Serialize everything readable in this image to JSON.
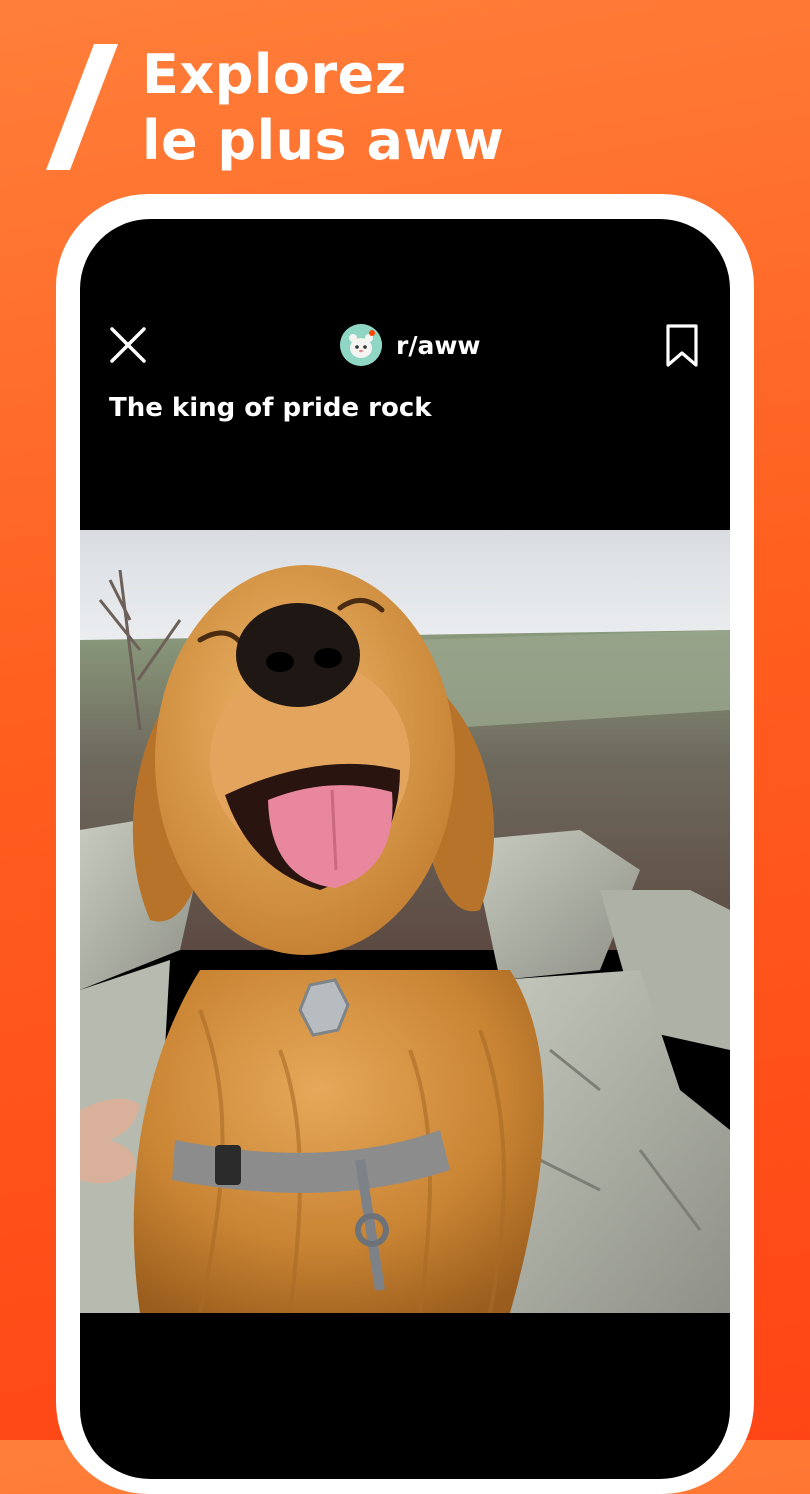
{
  "promo": {
    "title_line1": "Explorez",
    "title_line2": "le plus aww"
  },
  "post": {
    "community": "r/aww",
    "title": "The king of pride rock"
  },
  "icons": {
    "close": "close-icon",
    "bookmark": "bookmark-icon",
    "community_avatar": "subreddit-avatar-icon"
  },
  "colors": {
    "background_top": "#ff7f3a",
    "background_bottom": "#ff4515",
    "frame": "#ffffff",
    "screen": "#000000",
    "avatar": "#8fd6c4"
  }
}
